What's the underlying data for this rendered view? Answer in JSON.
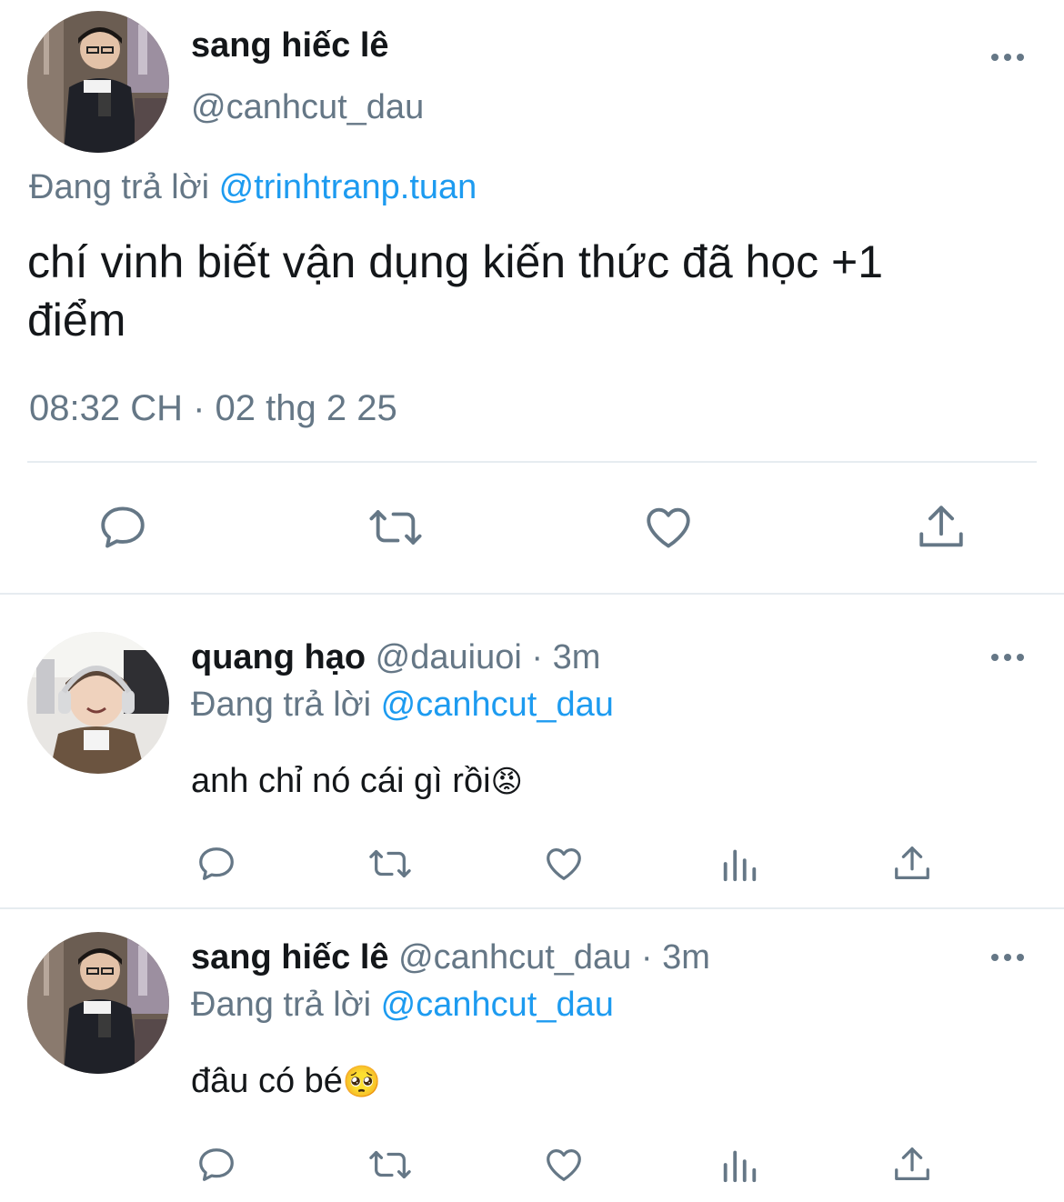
{
  "main_tweet": {
    "display_name": "sang hiếc lê",
    "handle": "@canhcut_dau",
    "replying_label": "Đang trả lời",
    "replying_to": "@trinhtranp.tuan",
    "text_line1": "chí vinh biết vận dụng kiến thức đã học +1",
    "text_line2": "điểm",
    "timestamp": "08:32 CH · 02 thg 2 25",
    "actions": [
      "reply-icon",
      "retweet-icon",
      "like-icon",
      "share-icon"
    ]
  },
  "replies": [
    {
      "display_name": "quang hạo",
      "handle": "@dauiuoi",
      "time": "· 3m",
      "replying_label": "Đang trả lời",
      "replying_to": "@canhcut_dau",
      "text": "anh chỉ nó cái gì rồi",
      "emoji": "😡"
    },
    {
      "display_name": "sang hiếc lê",
      "handle": "@canhcut_dau",
      "time": "· 3m",
      "replying_label": "Đang trả lời",
      "replying_to": "@canhcut_dau",
      "text": "đâu có bé",
      "emoji": "🥺"
    }
  ],
  "colors": {
    "link": "#1d9bf0",
    "muted": "#657786",
    "divider": "#e6ecf0"
  }
}
